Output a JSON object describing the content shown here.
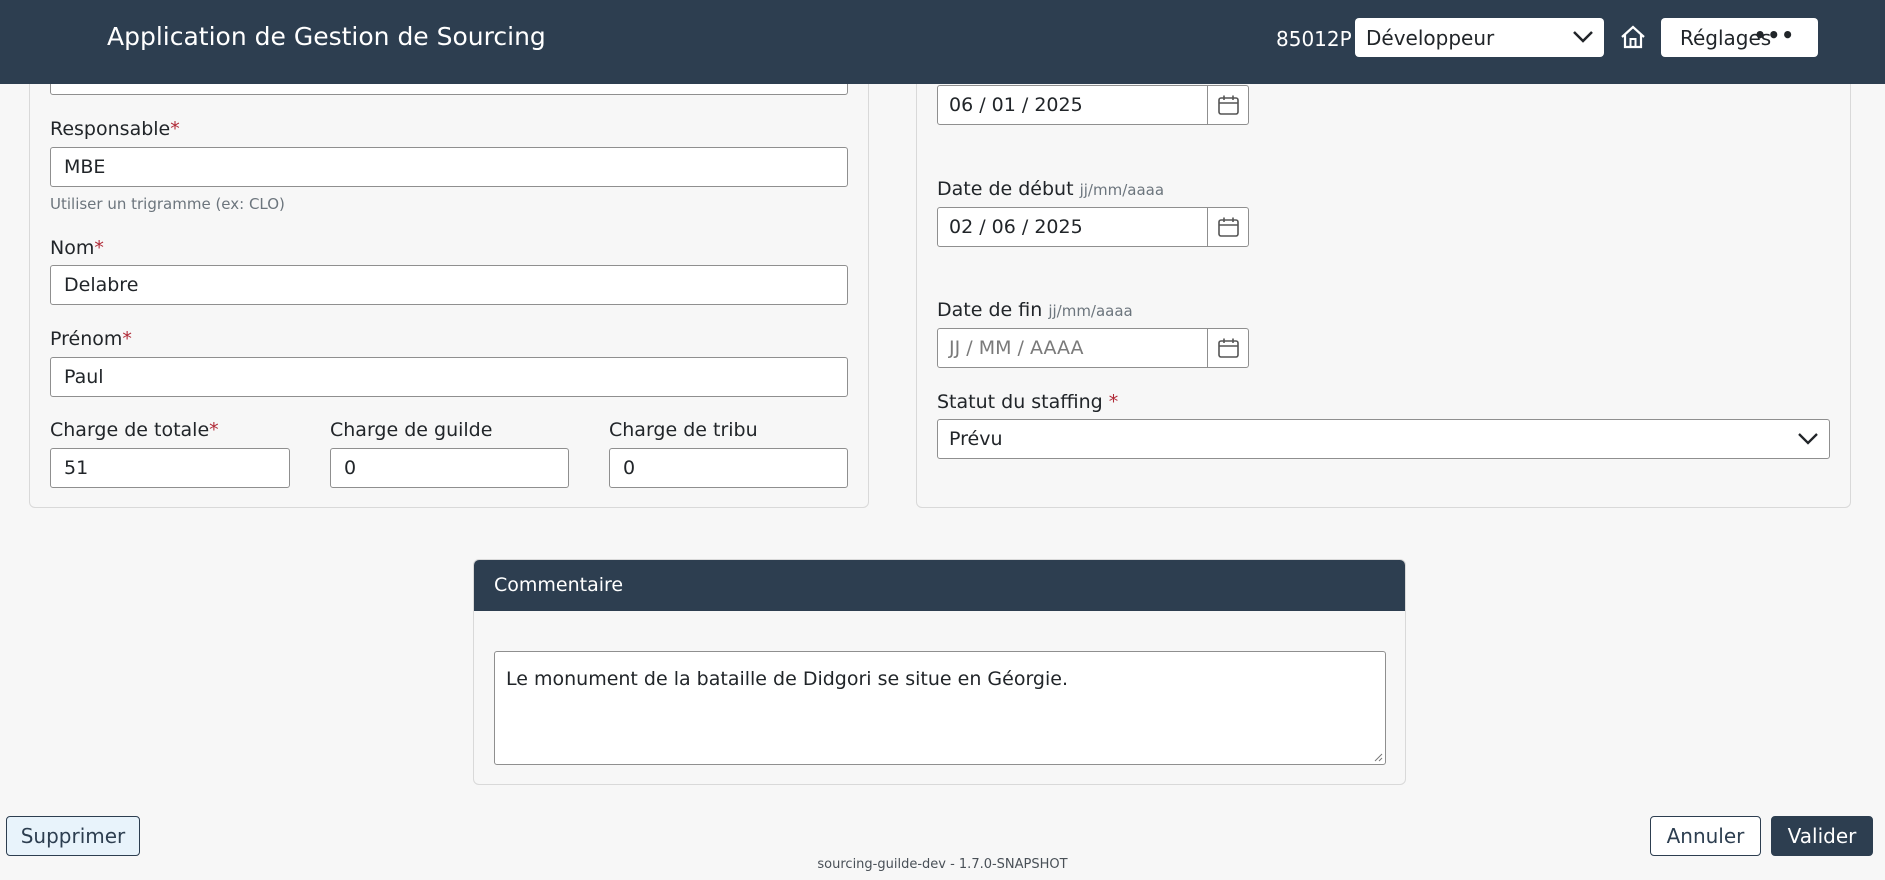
{
  "header": {
    "app_title": "Application de Gestion de Sourcing",
    "user_code": "85012P",
    "role_selected": "Développeur",
    "settings_label": "Réglages",
    "settings_more": "•••"
  },
  "form_left": {
    "responsable": {
      "label": "Responsable",
      "required": "*",
      "value": "MBE",
      "help": "Utiliser un trigramme (ex: CLO)"
    },
    "nom": {
      "label": "Nom",
      "required": "*",
      "value": "Delabre"
    },
    "prenom": {
      "label": "Prénom",
      "required": "*",
      "value": "Paul"
    },
    "charge_totale": {
      "label": "Charge de totale",
      "required": "*",
      "value": "51"
    },
    "charge_guilde": {
      "label": "Charge de guilde",
      "value": "0"
    },
    "charge_tribu": {
      "label": "Charge de tribu",
      "value": "0"
    }
  },
  "form_right": {
    "date_top": {
      "value": "06 / 01 / 2025"
    },
    "date_debut": {
      "label": "Date de début",
      "hint": "jj/mm/aaaa",
      "value": "02 / 06 / 2025"
    },
    "date_fin": {
      "label": "Date de fin",
      "hint": "jj/mm/aaaa",
      "placeholder": "JJ / MM / AAAA"
    },
    "statut": {
      "label": "Statut du staffing",
      "required": "*",
      "value": "Prévu"
    }
  },
  "comment": {
    "title": "Commentaire",
    "text": "Le monument de la bataille de Didgori se situe en Géorgie."
  },
  "actions": {
    "delete": "Supprimer",
    "cancel": "Annuler",
    "validate": "Valider"
  },
  "footer": {
    "version": "sourcing-guilde-dev - 1.7.0-SNAPSHOT"
  },
  "colors": {
    "navbar": "#2d3e50",
    "required": "#b02a37",
    "background": "#f7f7f7"
  }
}
